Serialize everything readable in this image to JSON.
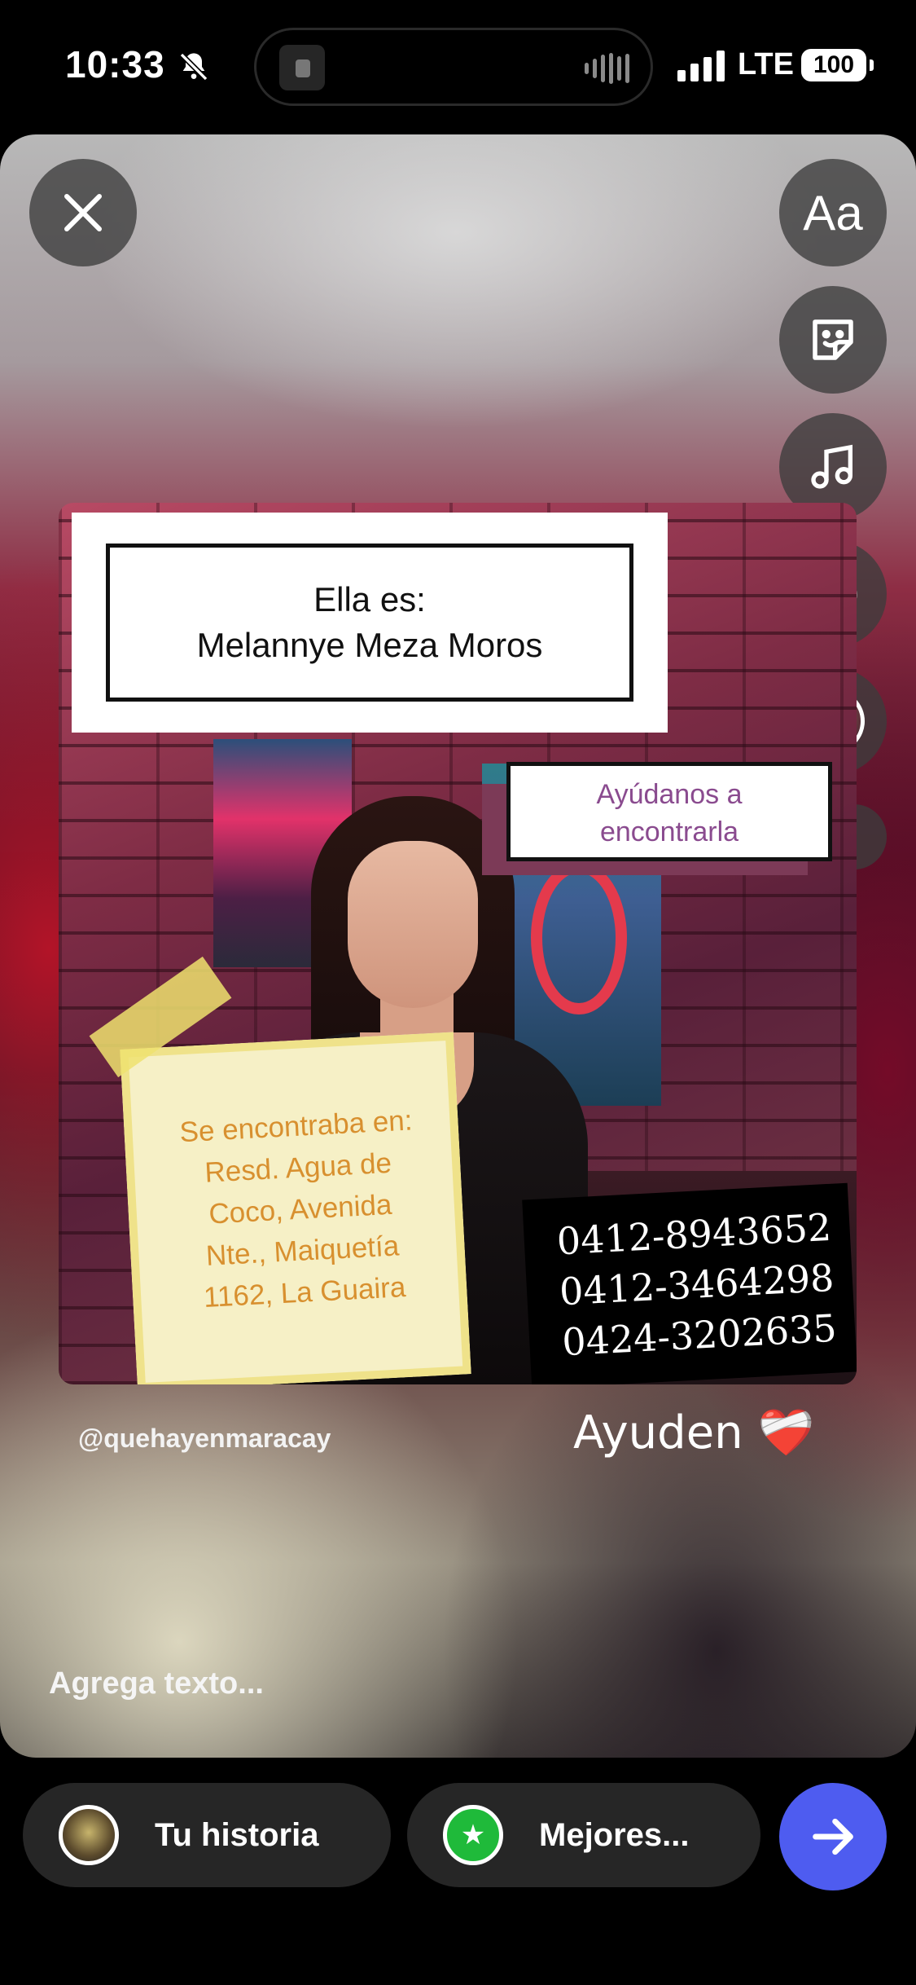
{
  "status_bar": {
    "time": "10:33",
    "network": "LTE",
    "battery": "100"
  },
  "editor": {
    "text_tool_label": "Aa",
    "post": {
      "name_line1": "Ella es:",
      "name_line2": "Melannye Meza Moros",
      "help_line1": "Ayúdanos a",
      "help_line2": "encontrarla",
      "location_lines": [
        "Se encontraba en:",
        "Resd. Agua de",
        "Coco, Avenida",
        "Nte., Maiquetía",
        "1162, La Guaira"
      ],
      "phones": [
        "0412-8943652",
        "0412-3464298",
        "0424-3202635"
      ]
    },
    "mention_sticker": "@quehayenmaracay",
    "caption_text": "Ayuden",
    "caption_emoji": "❤️‍🩹",
    "add_text_placeholder": "Agrega texto..."
  },
  "share_bar": {
    "your_story_label": "Tu historia",
    "close_friends_label": "Mejores...",
    "accent_color": "#4e5cf0",
    "close_friends_color": "#1fba3a"
  },
  "icons": [
    "close-icon",
    "sticker-icon",
    "music-icon",
    "mention-icon",
    "chevron-down-icon",
    "arrow-right-icon",
    "star-icon",
    "bell-off-icon"
  ]
}
